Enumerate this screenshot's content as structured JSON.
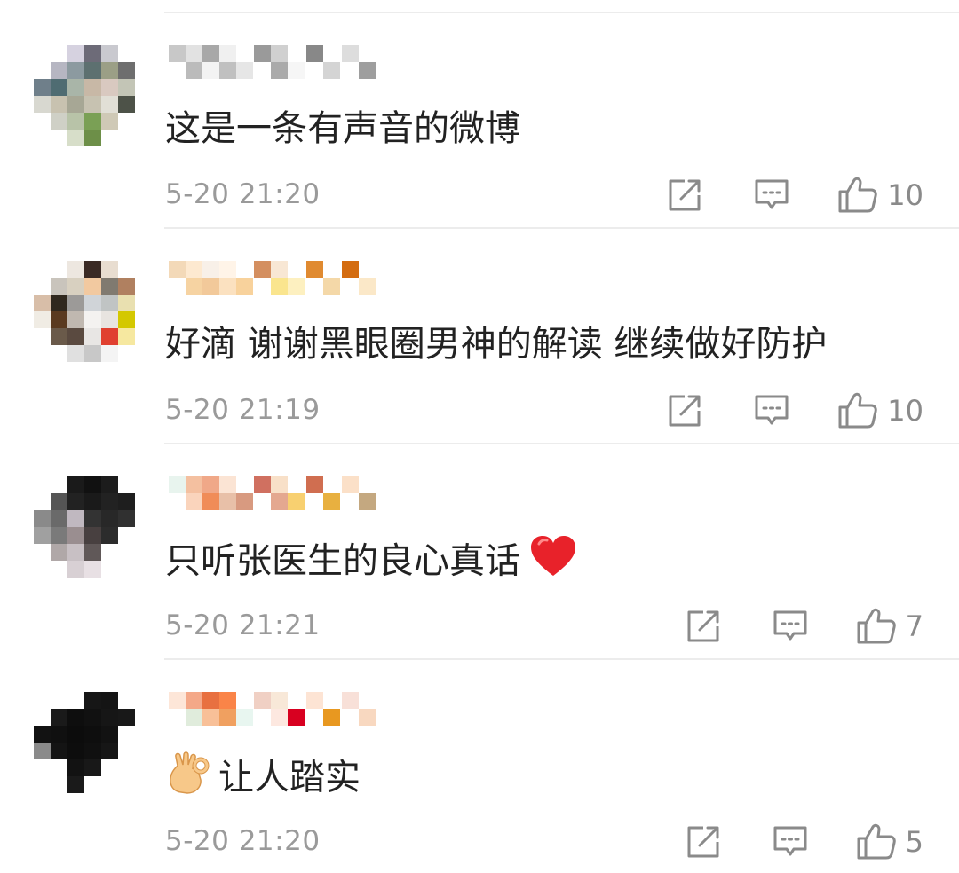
{
  "comments": [
    {
      "text": "这是一条有声音的微博",
      "time": "5-20 21:20",
      "likes": "10",
      "avatar": [
        "",
        "",
        "#d6d2e0",
        "#6d6b78",
        "#c9c9cf",
        "",
        "",
        "#b6b6c2",
        "#8c9aa0",
        "#5d7070",
        "#9b9f86",
        "#6e6e6e",
        "#6f7f8a",
        "#4f6c72",
        "#a9b5a8",
        "#c8b8a6",
        "#d9c9c0",
        "#c3c5b6",
        "#d8d8d0",
        "#c8c2b0",
        "#a7a795",
        "#c7c2b1",
        "#e1dfd6",
        "#4d5248",
        "",
        "#cfd0c6",
        "#b8c3a8",
        "#7aa055",
        "#cfc9b6",
        "",
        "",
        "",
        "#d7dec9",
        "#6d8f48",
        "",
        ""
      ],
      "name_pixels": [
        "#c8c8c8",
        "#e2e2e2",
        "#a8a8a8",
        "#f0f0f0",
        "#9a9a9a",
        "#d0d0d0",
        "#888888",
        "#dddddd",
        "#bbbbbb",
        "#f3f3f3",
        "#c0c0c0",
        "#e6e6e6",
        "#aaaaaa",
        "#f6f6f6",
        "#d4d4d4",
        "#9e9e9e"
      ]
    },
    {
      "text": "好滴 谢谢黑眼圈男神的解读 继续做好防护",
      "time": "5-20 21:19",
      "likes": "10",
      "avatar": [
        "",
        "",
        "#ede7e0",
        "#3a2a24",
        "#e8ddd0",
        "",
        "",
        "#c9c4bc",
        "#d8d0c0",
        "#f2c9a0",
        "#807a70",
        "#b08060",
        "#d8bea8",
        "#30281e",
        "#9c9a98",
        "#d0d4d8",
        "#c0c4c4",
        "#e9e0b0",
        "#f0ece4",
        "#5a3a20",
        "#c0b8b0",
        "#f4f2f0",
        "#e8e4e0",
        "#d4c800",
        "",
        "#6a5a4a",
        "#5a4a40",
        "#e8e6e4",
        "#e04030",
        "#f6e8a0",
        "",
        "",
        "#e0e0e0",
        "#c8c8c8",
        "#f4f4f4",
        ""
      ],
      "name_pixels": [
        "#f3d9b8",
        "#fde9d0",
        "#f8f0e8",
        "#fff4e8",
        "#d48f60",
        "#f8e7d4",
        "#e08a30",
        "#d46c10",
        "#f6d3a2",
        "#f2c99a",
        "#fbe1c0",
        "#f8d29c",
        "#fae58e",
        "#fdf0c0",
        "#f4d8a8",
        "#fbe8c8"
      ]
    },
    {
      "text": "只听张医生的良心真话",
      "time": "5-20 21:21",
      "likes": "7",
      "avatar": [
        "",
        "",
        "#1a1a1a",
        "#111111",
        "#1c1c1c",
        "",
        "",
        "#555555",
        "#222222",
        "#1a1a1a",
        "#222222",
        "#1e1e1e",
        "#8a8a8a",
        "#6a6a6a",
        "#c0b8c0",
        "#333333",
        "#282828",
        "#303030",
        "#a0a0a0",
        "#7a7a7a",
        "#9a8e90",
        "#484040",
        "#2c2c2c",
        "",
        "",
        "#b0a8a8",
        "#c8c0c4",
        "#605858",
        "",
        "",
        "",
        "",
        "#d8d0d4",
        "#e8e0e4",
        "",
        ""
      ],
      "name_pixels": [
        "#e8f4ee",
        "#f4c0a0",
        "#f0a888",
        "#fbe4d4",
        "#d07060",
        "#f8e0c8",
        "#d06e50",
        "#fbe0c8",
        "#fad4bc",
        "#f08c58",
        "#e8c0a8",
        "#d89a80",
        "#e4a890",
        "#f8d070",
        "#e8b040",
        "#c4a880"
      ]
    },
    {
      "text": "让人踏实",
      "time": "5-20 21:20",
      "likes": "5",
      "avatar": [
        "",
        "",
        "",
        "#161616",
        "#141414",
        "",
        "",
        "#1a1a1a",
        "#0e0e0e",
        "#111111",
        "#161616",
        "#181818",
        "#121212",
        "#101010",
        "#0c0c0c",
        "#0e0e0e",
        "#121212",
        "",
        "#8a8a8a",
        "#141414",
        "#0d0d0d",
        "#101010",
        "#161616",
        "",
        "",
        "",
        "#121212",
        "#181818",
        "",
        "",
        "",
        "",
        "#1a1a1a",
        "",
        "",
        ""
      ],
      "name_pixels": [
        "#fde6d8",
        "#f4a888",
        "#e87040",
        "#fa8448",
        "#f0d0c4",
        "#f8e8d8",
        "#fde4d4",
        "#f8e0d8",
        "#e0ecdc",
        "#f8c098",
        "#f0a060",
        "#e8f6f0",
        "#fde8e0",
        "#d80020",
        "#e89820",
        "#f8d8c0"
      ]
    }
  ],
  "icons": {
    "forward": "share-square-icon",
    "reply": "comment-bubble-icon",
    "like": "thumbs-up-icon",
    "heart": "red-heart-emoji",
    "ok_hand": "ok-hand-emoji"
  },
  "colors": {
    "text": "#222222",
    "meta": "#9a9a9a",
    "icon": "#8a8a8a",
    "heart": "#e8222a",
    "divider": "#ececec"
  }
}
